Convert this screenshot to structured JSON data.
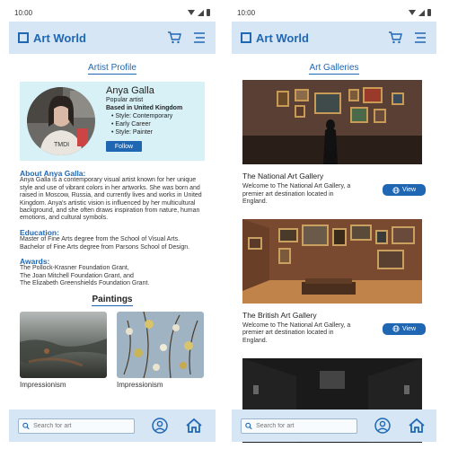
{
  "status": {
    "time": "10:00"
  },
  "app": {
    "name": "Art World"
  },
  "profile_screen": {
    "section_title": "Artist Profile",
    "artist": {
      "name": "Anya Galla",
      "subtitle": "Popular artist",
      "location": "Based in United Kingdom",
      "styles": [
        "• Style: Contemporary",
        "• Early Career",
        "• Style: Painter"
      ],
      "follow_label": "Follow"
    },
    "about": {
      "heading": "About Anya Galla:",
      "text": "Anya Galla is a contemporary visual artist known for her unique style and use of vibrant colors in her artworks. She was born and raised in Moscow, Russia, and currently lives and works in United Kingdom. Anya's artistic vision is influenced by her multicultural background, and she often draws inspiration from nature, human emotions, and cultural symbols."
    },
    "education": {
      "heading": "Education:",
      "text": "Master of Fine Arts degree from the School of Visual Arts. Bachelor of Fine Arts degree from Parsons School of Design."
    },
    "awards": {
      "heading": "Awards:",
      "lines": [
        "The Pollock-Krasner Foundation Grant,",
        "The Joan Mitchell Foundation Grant, and",
        "The Elizabeth Greenshields Foundation Grant."
      ]
    },
    "paintings_title": "Paintings",
    "paintings": [
      {
        "label": "Impressionism"
      },
      {
        "label": "Impressionism"
      }
    ]
  },
  "galleries_screen": {
    "section_title": "Art Galleries",
    "galleries": [
      {
        "name": "The National Art Gallery",
        "description": "Welcome to The National Art Gallery, a premier art destination located in England.",
        "view_label": "View"
      },
      {
        "name": "The British Art Gallery",
        "description": "Welcome to The National Art Gallery, a premier art destination located in England.",
        "view_label": "View"
      }
    ]
  },
  "bottom_bar": {
    "search_placeholder": "Search for art"
  },
  "colors": {
    "accent": "#1f67b3",
    "bar_bg": "#d6e6f5",
    "card_bg": "#d8f1f7"
  },
  "icons": [
    "cart-icon",
    "menu-icon",
    "search-icon",
    "user-icon",
    "home-icon",
    "globe-icon"
  ]
}
